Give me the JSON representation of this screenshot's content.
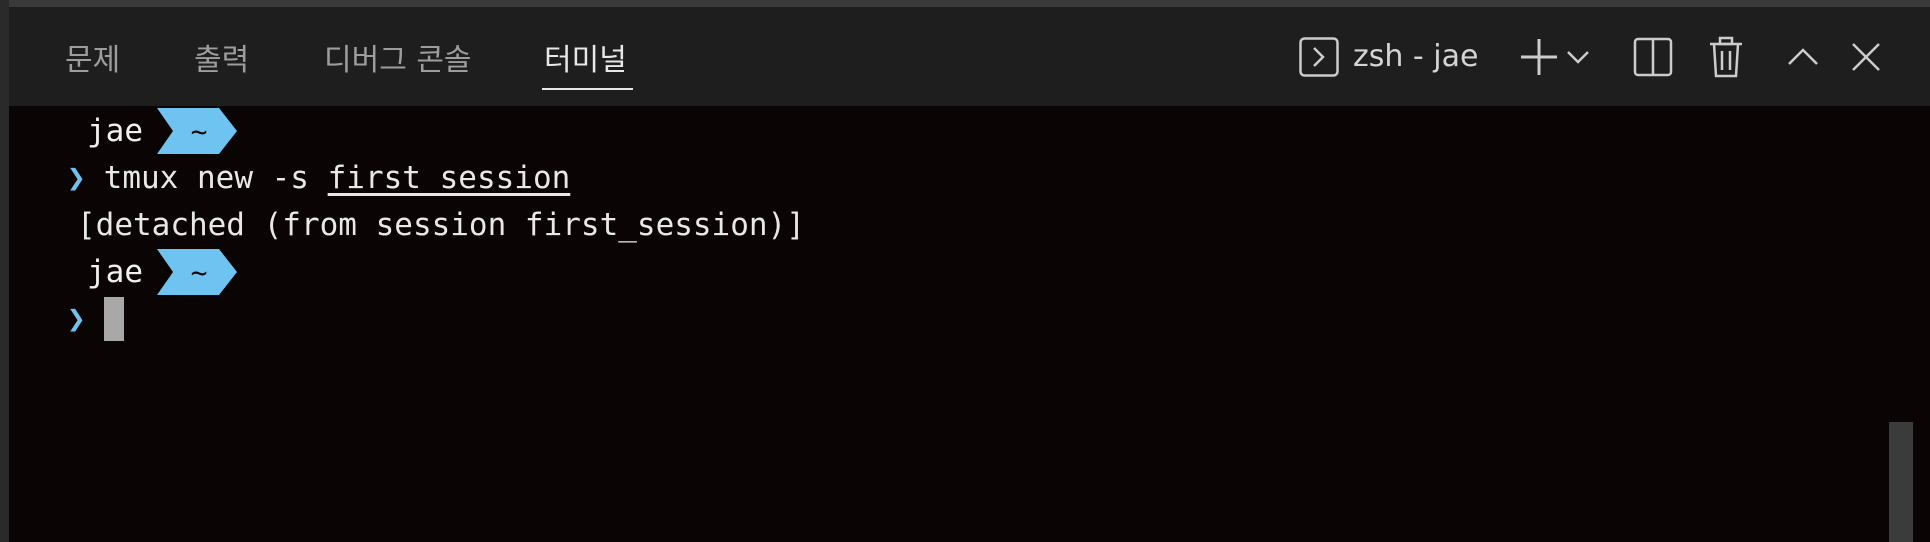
{
  "panel": {
    "tabs": [
      {
        "label": "문제"
      },
      {
        "label": "출력"
      },
      {
        "label": "디버그 콘솔"
      },
      {
        "label": "터미널"
      }
    ],
    "active_tab_index": 3,
    "session_label": "zsh - jae",
    "icons": {
      "shell": "terminal-shell-icon",
      "new": "plus-icon",
      "dropdown": "chevron-down-icon",
      "split": "split-icon",
      "trash": "trash-icon",
      "maximize": "chevron-up-icon",
      "close": "close-icon"
    }
  },
  "terminal": {
    "lines": [
      {
        "type": "prompt",
        "user": "jae",
        "dir": "~"
      },
      {
        "type": "command",
        "symbol": "❯",
        "cmd": "tmux new -s ",
        "arg": "first_session"
      },
      {
        "type": "output",
        "text": "[detached (from session first_session)]"
      },
      {
        "type": "prompt",
        "user": "jae",
        "dir": "~"
      },
      {
        "type": "input",
        "symbol": "❯"
      }
    ]
  },
  "colors": {
    "panel_bg": "#1e1e1e",
    "terminal_bg": "#0a0404",
    "badge": "#6ec3f0",
    "chevron": "#6ec3f0",
    "cursor": "#a8a8a8"
  }
}
